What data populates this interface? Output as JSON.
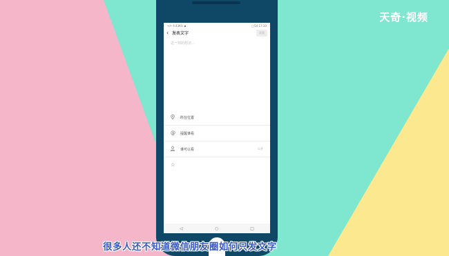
{
  "watermark": "天奇·视频",
  "status": {
    "left": "•ıl• 4.43K/s ◾",
    "right": "□54 17:10"
  },
  "topbar": {
    "back_glyph": "‹",
    "title": "发表文字",
    "publish_label": "发表"
  },
  "compose": {
    "placeholder": "这一刻的想法..."
  },
  "options": [
    {
      "label": "所在位置",
      "value": ""
    },
    {
      "label": "提醒谁看",
      "value": ""
    },
    {
      "label": "谁可以看",
      "value": "公开"
    }
  ],
  "icons": {
    "location": "location-icon",
    "mention": "at-icon",
    "privacy": "person-icon",
    "favorite": "star-icon"
  },
  "navbar": {
    "back": "◁",
    "home": "○",
    "recent": "□"
  },
  "subtitle": "很多人还不知道微信朋友圈如何只发文字",
  "colors": {
    "pink": "#f4b6c8",
    "mint": "#7fe7cf",
    "yellow": "#fbe88f",
    "phone": "#0f4766",
    "subtitle": "#3b59c2"
  }
}
